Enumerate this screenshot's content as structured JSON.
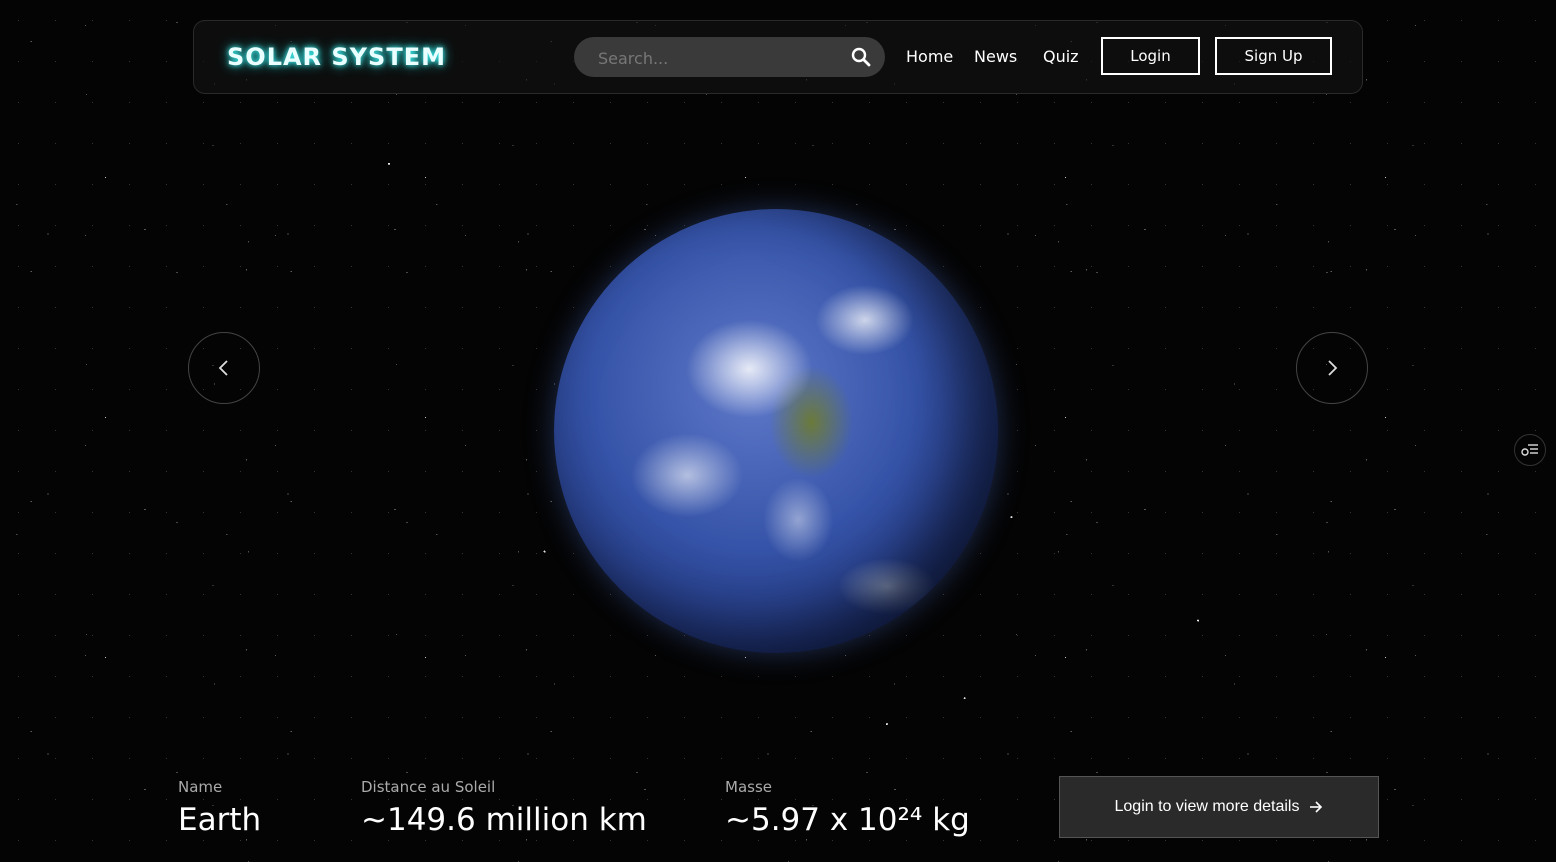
{
  "header": {
    "logo": "SOLAR SYSTEM",
    "search_placeholder": "Search...",
    "nav": [
      "Home",
      "News",
      "Quiz"
    ],
    "login_label": "Login",
    "signup_label": "Sign Up"
  },
  "planet": {
    "image": "earth-globe"
  },
  "info": {
    "name_label": "Name",
    "name_value": "Earth",
    "distance_label": "Distance au Soleil",
    "distance_value": "~149.6 million km",
    "mass_label": "Masse",
    "mass_value": "~5.97 x 10²⁴ kg"
  },
  "cta": {
    "label": "Login to view more details"
  },
  "icons": {
    "prev": "chevron-left-icon",
    "next": "chevron-right-icon",
    "search": "search-icon",
    "side_tool": "settings-list-icon",
    "cta_arrow": "arrow-right-icon"
  },
  "colors": {
    "background": "#040404",
    "logo_glow": "#44ffff",
    "button_bg": "#2a2a2a"
  }
}
